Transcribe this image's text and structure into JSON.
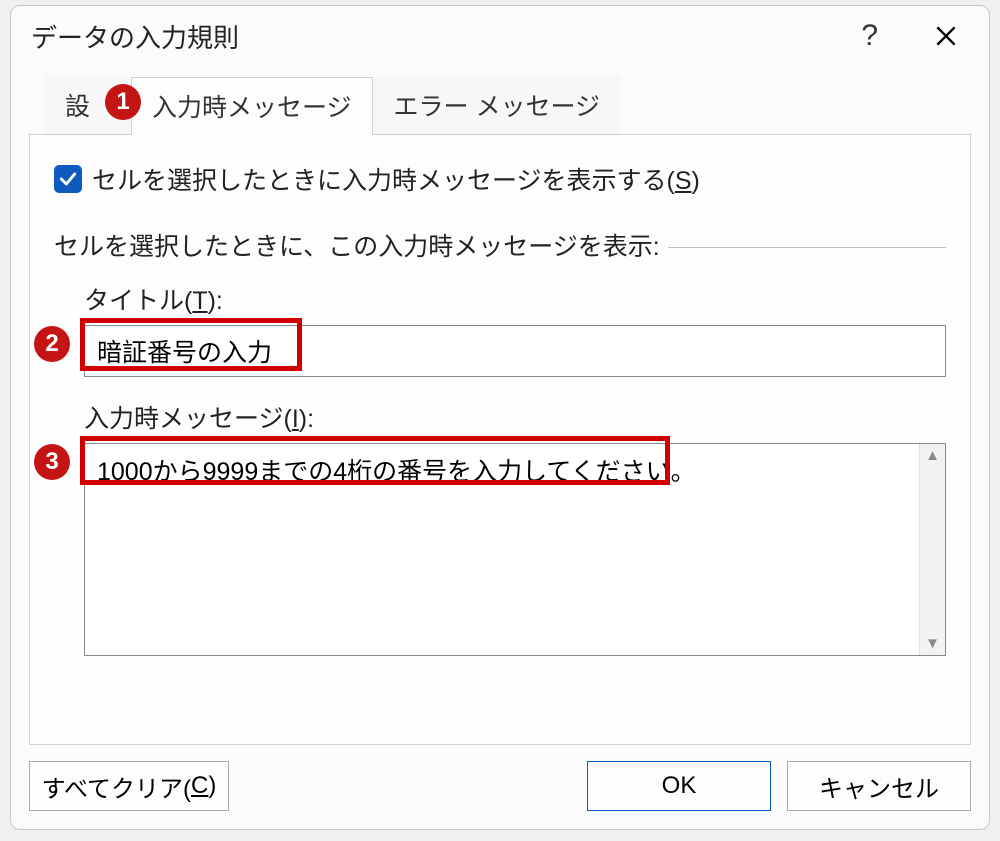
{
  "dialog": {
    "title": "データの入力規則"
  },
  "tabs": {
    "settings": "設",
    "input_message": "入力時メッセージ",
    "error_message": "エラー メッセージ"
  },
  "checkbox": {
    "label": "セルを選択したときに入力時メッセージを表示する(S)"
  },
  "section": {
    "header": "セルを選択したときに、この入力時メッセージを表示:"
  },
  "fields": {
    "title_label": "タイトル(T):",
    "title_value": "暗証番号の入力",
    "message_label": "入力時メッセージ(I):",
    "message_value": "1000から9999までの4桁の番号を入力してください。"
  },
  "buttons": {
    "clear": "すべてクリア(C)",
    "ok": "OK",
    "cancel": "キャンセル"
  },
  "annotations": {
    "b1": "1",
    "b2": "2",
    "b3": "3"
  }
}
